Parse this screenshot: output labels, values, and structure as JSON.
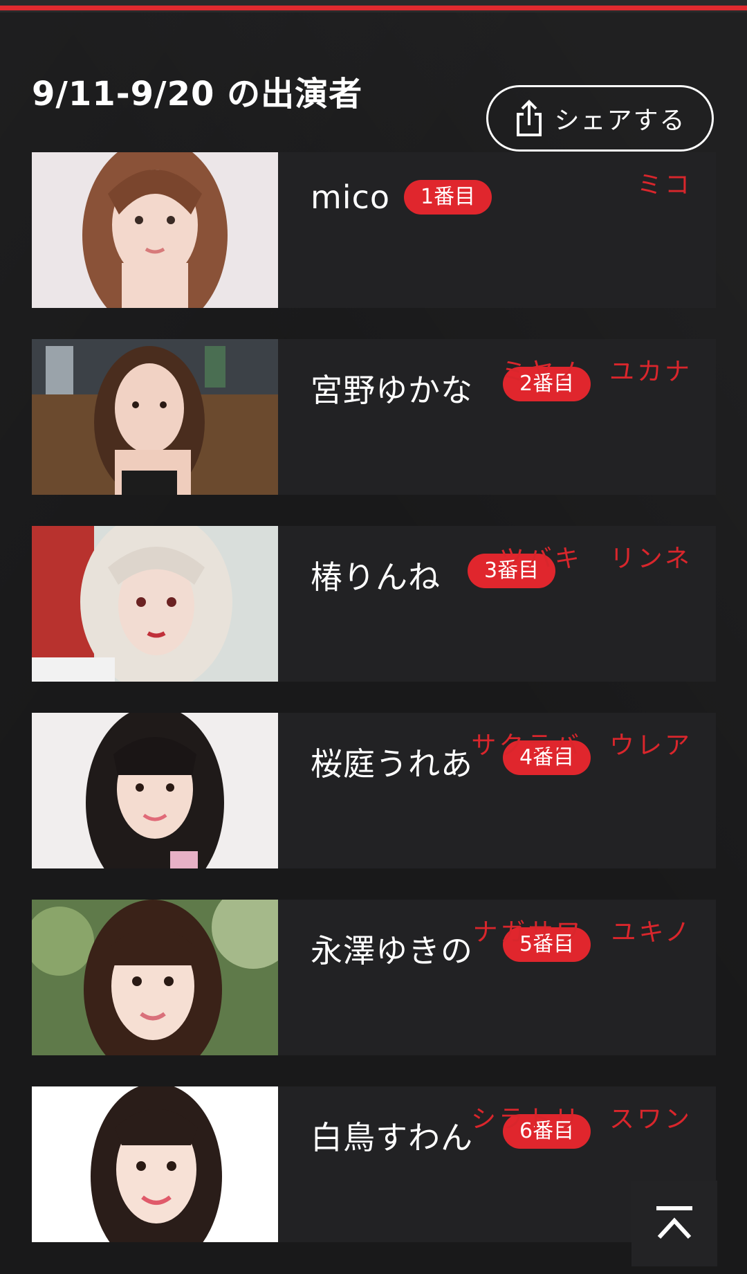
{
  "section": {
    "title": "9/11-9/20 の出演者"
  },
  "share": {
    "label": "シェアする",
    "icon": "share-icon"
  },
  "colors": {
    "accent": "#e0262d",
    "background": "#19191a",
    "card": "#222224"
  },
  "performers": [
    {
      "name": "mico",
      "kana": "ミコ",
      "order": "1番目"
    },
    {
      "name": "宮野ゆかな",
      "kana": "ミヤノ　ユカナ",
      "order": "2番目"
    },
    {
      "name": "椿りんね",
      "kana": "ツバキ　リンネ",
      "order": "3番目"
    },
    {
      "name": "桜庭うれあ",
      "kana": "サクラバ　ウレア",
      "order": "4番目"
    },
    {
      "name": "永澤ゆきの",
      "kana": "ナガサワ　ユキノ",
      "order": "5番目"
    },
    {
      "name": "白鳥すわん",
      "kana": "シラトリ　スワン",
      "order": "6番目"
    }
  ],
  "scroll_top": {
    "icon": "chevron-up-icon"
  }
}
